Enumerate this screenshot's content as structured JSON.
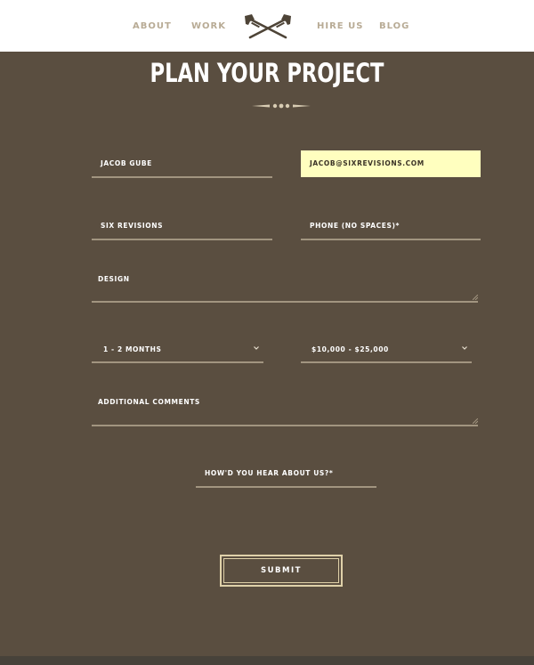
{
  "nav": {
    "items": [
      {
        "label": "ABOUT"
      },
      {
        "label": "WORK"
      },
      {
        "label": "HIRE US"
      },
      {
        "label": "BLOG"
      }
    ],
    "logo_icon": "crossed-pipe-wrenches-icon"
  },
  "page": {
    "title": "PLAN YOUR PROJECT",
    "ornament_icon": "divider-ornament-icon"
  },
  "form": {
    "name": {
      "value": "JACOB GUBE"
    },
    "email": {
      "value": "JACOB@SIXREVISIONS.COM"
    },
    "company": {
      "value": "SIX REVISIONS"
    },
    "phone": {
      "placeholder": "PHONE (NO SPACES)*"
    },
    "services": {
      "value": "DESIGN"
    },
    "timeline": {
      "selected": "1 - 2 MONTHS"
    },
    "budget": {
      "selected": "$10,000 - $25,000"
    },
    "comments": {
      "placeholder": "ADDITIONAL COMMENTS"
    },
    "referral": {
      "placeholder": "HOW'D YOU HEAR ABOUT US?*"
    },
    "submit_label": "SUBMIT"
  },
  "colors": {
    "background": "#5a4e40",
    "highlight_field": "#ffffbf",
    "nav_text": "#b8ab95",
    "button_border": "#dfd1a9"
  }
}
